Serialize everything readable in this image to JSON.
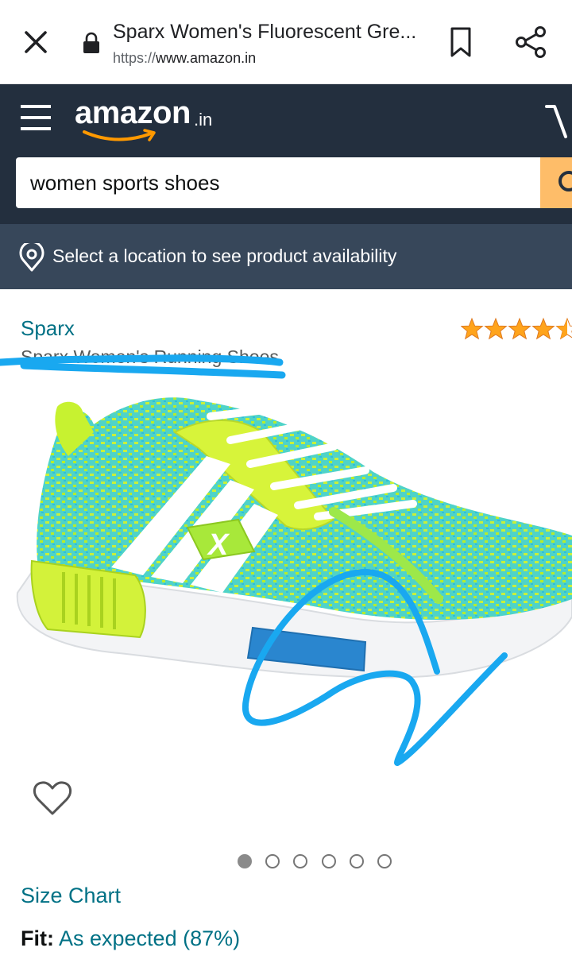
{
  "browser": {
    "tab_title": "Sparx Women's Fluorescent Gre...",
    "url_scheme": "https://",
    "url_host": "www.amazon.in"
  },
  "header": {
    "logo_text": "amazon",
    "logo_tld": ".in",
    "search_value": "women sports shoes"
  },
  "location_bar": {
    "text": "Select a location to see product availability"
  },
  "product": {
    "brand": "Sparx",
    "subtitle": "Sparx Women's Running Shoes",
    "rating_stars": 4.5,
    "image_count": 6,
    "active_image_index": 0,
    "size_chart_label": "Size Chart",
    "fit_label": "Fit:",
    "fit_value": "As expected (87%)"
  },
  "colors": {
    "header_bg": "#232f3e",
    "location_bg": "#37475a",
    "link": "#007185",
    "star": "#ffa41c",
    "search_button": "#febd69",
    "annotation": "#19a8f0"
  },
  "icons": {
    "close": "close-icon",
    "lock": "lock-icon",
    "bookmark": "bookmark-icon",
    "share": "share-icon",
    "menu": "hamburger-icon",
    "cart": "cart-icon",
    "location": "location-pin-icon",
    "wishlist": "heart-icon"
  }
}
